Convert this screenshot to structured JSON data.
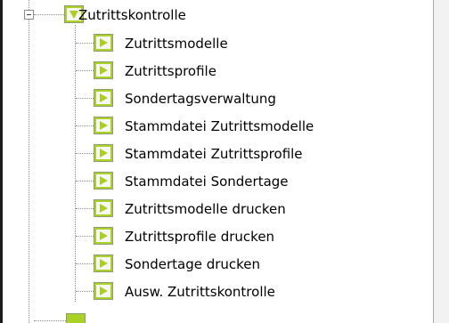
{
  "tree": {
    "parent": {
      "label": "Zutrittskontrolle",
      "icon": "collapse-node-icon",
      "state": "expanded"
    },
    "children": [
      {
        "label": "Zutrittsmodelle",
        "icon": "play-node-icon"
      },
      {
        "label": "Zutrittsprofile",
        "icon": "play-node-icon"
      },
      {
        "label": "Sondertagsverwaltung",
        "icon": "play-node-icon"
      },
      {
        "label": "Stammdatei Zutrittsmodelle",
        "icon": "play-node-icon"
      },
      {
        "label": "Stammdatei Zutrittsprofile",
        "icon": "play-node-icon"
      },
      {
        "label": "Stammdatei Sondertage",
        "icon": "play-node-icon"
      },
      {
        "label": "Zutrittsmodelle drucken",
        "icon": "play-node-icon"
      },
      {
        "label": "Zutrittsprofile drucken",
        "icon": "play-node-icon"
      },
      {
        "label": "Sondertage drucken",
        "icon": "play-node-icon"
      },
      {
        "label": "Ausw. Zutrittskontrolle",
        "icon": "play-node-icon"
      }
    ]
  },
  "colors": {
    "node_green": "#a9d126",
    "line_gray": "#8c8c8c",
    "text": "#000000",
    "background": "#ffffff"
  }
}
